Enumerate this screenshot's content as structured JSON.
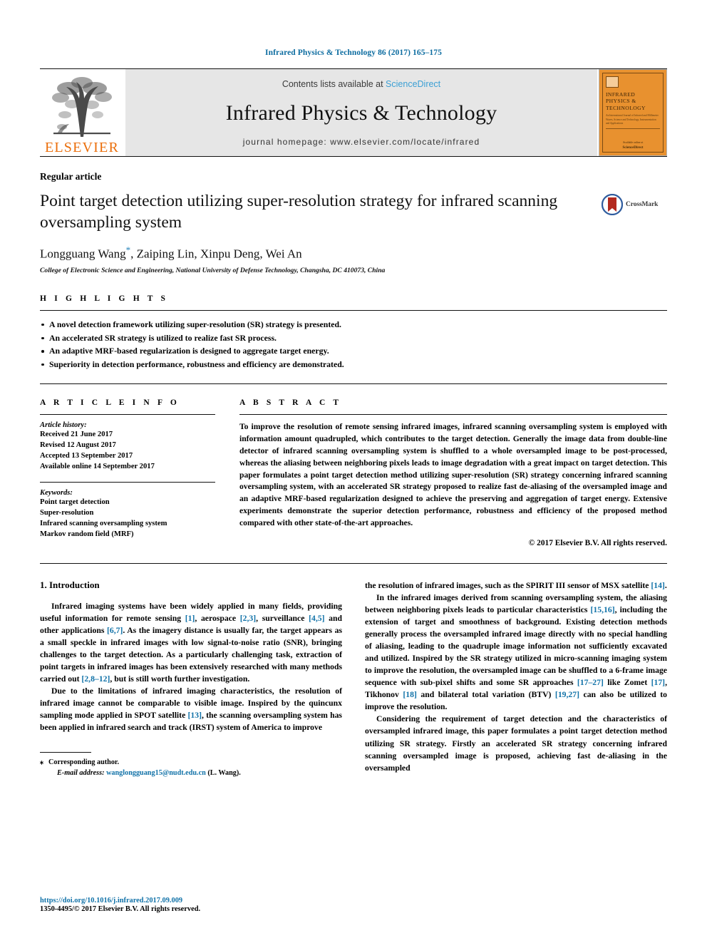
{
  "running_head": "Infrared Physics & Technology 86 (2017) 165–175",
  "masthead": {
    "contents_prefix": "Contents lists available at ",
    "sciencedirect": "ScienceDirect",
    "journal_title": "Infrared Physics & Technology",
    "homepage": "journal homepage: www.elsevier.com/locate/infrared",
    "elsevier_wordmark": "ELSEVIER",
    "cover": {
      "title": "INFRARED PHYSICS & TECHNOLOGY",
      "subtitle": "An International Journal of Infrared and Millimeter Waves, Science and Technology, Instrumentation and Applications",
      "footer_label": "Available online at",
      "footer_brand": "ScienceDirect"
    }
  },
  "article": {
    "type": "Regular article",
    "title": "Point target detection utilizing super-resolution strategy for infrared scanning oversampling system",
    "authors": "Longguang Wang",
    "authors_rest": ", Zaiping Lin, Xinpu Deng, Wei An",
    "corresponding_marker": "*",
    "affiliation": "College of Electronic Science and Engineering, National University of Defense Technology, Changsha, DC 410073, China",
    "crossmark_label": "CrossMark"
  },
  "highlights": {
    "label": "H I G H L I G H T S",
    "items": [
      "A novel detection framework utilizing super-resolution (SR) strategy is presented.",
      "An accelerated SR strategy is utilized to realize fast SR process.",
      "An adaptive MRF-based regularization is designed to aggregate target energy.",
      "Superiority in detection performance, robustness and efficiency are demonstrated."
    ]
  },
  "article_info": {
    "label": "A R T I C L E  I N F O",
    "history_head": "Article history:",
    "history": [
      "Received 21 June 2017",
      "Revised 12 August 2017",
      "Accepted 13 September 2017",
      "Available online 14 September 2017"
    ],
    "keywords_head": "Keywords:",
    "keywords": [
      "Point target detection",
      "Super-resolution",
      "Infrared scanning oversampling system",
      "Markov random field (MRF)"
    ]
  },
  "abstract": {
    "label": "A B S T R A C T",
    "text": "To improve the resolution of remote sensing infrared images, infrared scanning oversampling system is employed with information amount quadrupled, which contributes to the target detection. Generally the image data from double-line detector of infrared scanning oversampling system is shuffled to a whole oversampled image to be post-processed, whereas the aliasing between neighboring pixels leads to image degradation with a great impact on target detection. This paper formulates a point target detection method utilizing super-resolution (SR) strategy concerning infrared scanning oversampling system, with an accelerated SR strategy proposed to realize fast de-aliasing of the oversampled image and an adaptive MRF-based regularization designed to achieve the preserving and aggregation of target energy. Extensive experiments demonstrate the superior detection performance, robustness and efficiency of the proposed method compared with other state-of-the-art approaches.",
    "copyright": "© 2017 Elsevier B.V. All rights reserved."
  },
  "body": {
    "section_title": "1. Introduction",
    "left_paragraphs": [
      {
        "parts": [
          {
            "t": "Infrared imaging systems have been widely applied in many fields, providing useful information for remote sensing "
          },
          {
            "t": "[1]",
            "ref": true
          },
          {
            "t": ", aerospace "
          },
          {
            "t": "[2,3]",
            "ref": true
          },
          {
            "t": ", surveillance "
          },
          {
            "t": "[4,5]",
            "ref": true
          },
          {
            "t": " and other applications "
          },
          {
            "t": "[6,7]",
            "ref": true
          },
          {
            "t": ". As the imagery distance is usually far, the target appears as a small speckle in infrared images with low signal-to-noise ratio (SNR), bringing challenges to the target detection. As a particularly challenging task, extraction of point targets in infrared images has been extensively researched with many methods carried out "
          },
          {
            "t": "[2,8–12]",
            "ref": true
          },
          {
            "t": ", but is still worth further investigation."
          }
        ]
      },
      {
        "parts": [
          {
            "t": "Due to the limitations of infrared imaging characteristics, the resolution of infrared image cannot be comparable to visible image. Inspired by the quincunx sampling mode applied in SPOT satellite "
          },
          {
            "t": "[13]",
            "ref": true
          },
          {
            "t": ", the scanning oversampling system has been applied in infrared search and track (IRST) system of America to improve"
          }
        ]
      }
    ],
    "right_paragraphs": [
      {
        "indent": false,
        "parts": [
          {
            "t": "the resolution of infrared images, such as the SPIRIT III sensor of MSX satellite "
          },
          {
            "t": "[14]",
            "ref": true
          },
          {
            "t": "."
          }
        ]
      },
      {
        "indent": true,
        "parts": [
          {
            "t": "In the infrared images derived from scanning oversampling system, the aliasing between neighboring pixels leads to particular characteristics "
          },
          {
            "t": "[15,16]",
            "ref": true
          },
          {
            "t": ", including the extension of target and smoothness of background. Existing detection methods generally process the oversampled infrared image directly with no special handling of aliasing, leading to the quadruple image information not sufficiently excavated and utilized. Inspired by the SR strategy utilized in micro-scanning imaging system to improve the resolution, the oversampled image can be shuffled to a 6-frame image sequence with sub-pixel shifts and some SR approaches "
          },
          {
            "t": "[17–27]",
            "ref": true
          },
          {
            "t": " like Zomet "
          },
          {
            "t": "[17]",
            "ref": true
          },
          {
            "t": ", Tikhonov "
          },
          {
            "t": "[18]",
            "ref": true
          },
          {
            "t": " and bilateral total variation (BTV) "
          },
          {
            "t": "[19,27]",
            "ref": true
          },
          {
            "t": " can also be utilized to improve the resolution."
          }
        ]
      },
      {
        "indent": true,
        "parts": [
          {
            "t": "Considering the requirement of target detection and the characteristics of oversampled infrared image, this paper formulates a point target detection method utilizing SR strategy. Firstly an accelerated SR strategy concerning infrared scanning oversampled image is proposed, achieving fast de-aliasing in the oversampled"
          }
        ]
      }
    ]
  },
  "footnotes": {
    "corresponding": "Corresponding author.",
    "email_label": "E-mail address:",
    "email": "wanglongguang15@nudt.edu.cn",
    "email_owner": "(L. Wang).",
    "doi": "https://doi.org/10.1016/j.infrared.2017.09.009",
    "issn_line": "1350-4495/© 2017 Elsevier B.V. All rights reserved."
  },
  "colors": {
    "link": "#1172a8",
    "sciencedirect": "#3b9fd4",
    "elsevier_orange": "#eb6e0a",
    "reference": "#1172a8",
    "header_blue": "#0c6ca0"
  }
}
